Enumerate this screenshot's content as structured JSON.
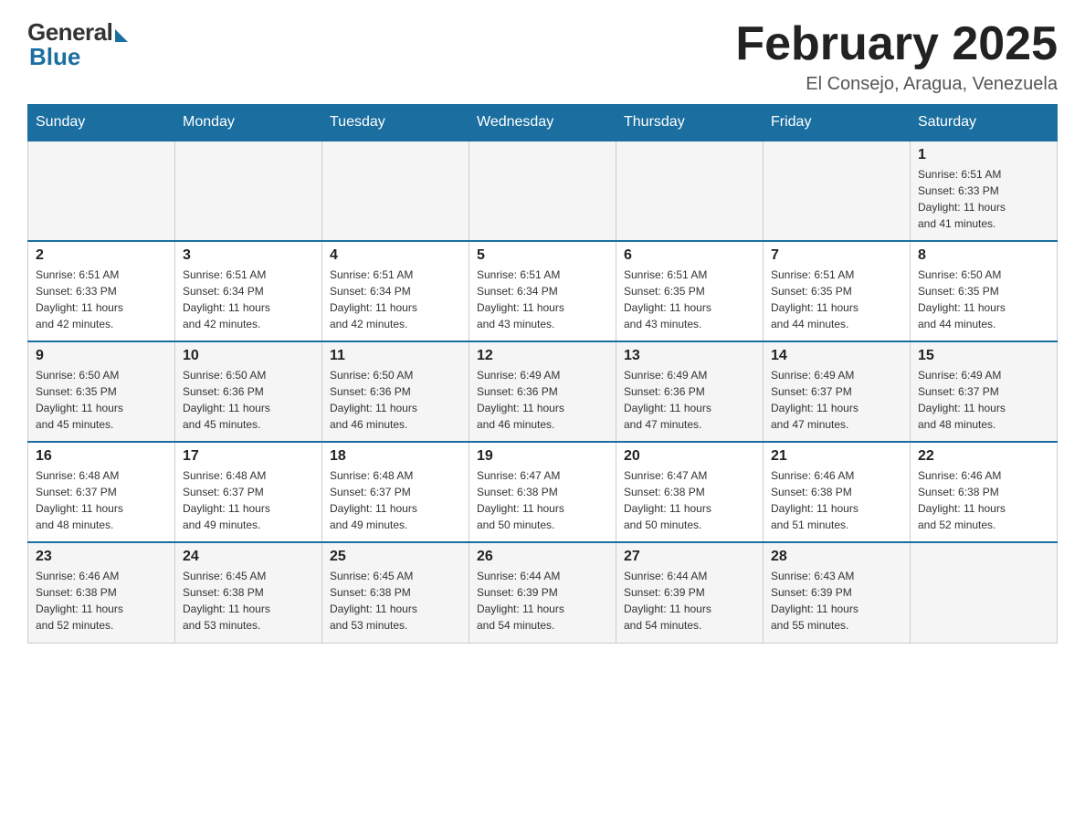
{
  "logo": {
    "general": "General",
    "blue": "Blue"
  },
  "title": {
    "month_year": "February 2025",
    "location": "El Consejo, Aragua, Venezuela"
  },
  "weekdays": [
    "Sunday",
    "Monday",
    "Tuesday",
    "Wednesday",
    "Thursday",
    "Friday",
    "Saturday"
  ],
  "weeks": [
    [
      {
        "day": "",
        "info": ""
      },
      {
        "day": "",
        "info": ""
      },
      {
        "day": "",
        "info": ""
      },
      {
        "day": "",
        "info": ""
      },
      {
        "day": "",
        "info": ""
      },
      {
        "day": "",
        "info": ""
      },
      {
        "day": "1",
        "info": "Sunrise: 6:51 AM\nSunset: 6:33 PM\nDaylight: 11 hours\nand 41 minutes."
      }
    ],
    [
      {
        "day": "2",
        "info": "Sunrise: 6:51 AM\nSunset: 6:33 PM\nDaylight: 11 hours\nand 42 minutes."
      },
      {
        "day": "3",
        "info": "Sunrise: 6:51 AM\nSunset: 6:34 PM\nDaylight: 11 hours\nand 42 minutes."
      },
      {
        "day": "4",
        "info": "Sunrise: 6:51 AM\nSunset: 6:34 PM\nDaylight: 11 hours\nand 42 minutes."
      },
      {
        "day": "5",
        "info": "Sunrise: 6:51 AM\nSunset: 6:34 PM\nDaylight: 11 hours\nand 43 minutes."
      },
      {
        "day": "6",
        "info": "Sunrise: 6:51 AM\nSunset: 6:35 PM\nDaylight: 11 hours\nand 43 minutes."
      },
      {
        "day": "7",
        "info": "Sunrise: 6:51 AM\nSunset: 6:35 PM\nDaylight: 11 hours\nand 44 minutes."
      },
      {
        "day": "8",
        "info": "Sunrise: 6:50 AM\nSunset: 6:35 PM\nDaylight: 11 hours\nand 44 minutes."
      }
    ],
    [
      {
        "day": "9",
        "info": "Sunrise: 6:50 AM\nSunset: 6:35 PM\nDaylight: 11 hours\nand 45 minutes."
      },
      {
        "day": "10",
        "info": "Sunrise: 6:50 AM\nSunset: 6:36 PM\nDaylight: 11 hours\nand 45 minutes."
      },
      {
        "day": "11",
        "info": "Sunrise: 6:50 AM\nSunset: 6:36 PM\nDaylight: 11 hours\nand 46 minutes."
      },
      {
        "day": "12",
        "info": "Sunrise: 6:49 AM\nSunset: 6:36 PM\nDaylight: 11 hours\nand 46 minutes."
      },
      {
        "day": "13",
        "info": "Sunrise: 6:49 AM\nSunset: 6:36 PM\nDaylight: 11 hours\nand 47 minutes."
      },
      {
        "day": "14",
        "info": "Sunrise: 6:49 AM\nSunset: 6:37 PM\nDaylight: 11 hours\nand 47 minutes."
      },
      {
        "day": "15",
        "info": "Sunrise: 6:49 AM\nSunset: 6:37 PM\nDaylight: 11 hours\nand 48 minutes."
      }
    ],
    [
      {
        "day": "16",
        "info": "Sunrise: 6:48 AM\nSunset: 6:37 PM\nDaylight: 11 hours\nand 48 minutes."
      },
      {
        "day": "17",
        "info": "Sunrise: 6:48 AM\nSunset: 6:37 PM\nDaylight: 11 hours\nand 49 minutes."
      },
      {
        "day": "18",
        "info": "Sunrise: 6:48 AM\nSunset: 6:37 PM\nDaylight: 11 hours\nand 49 minutes."
      },
      {
        "day": "19",
        "info": "Sunrise: 6:47 AM\nSunset: 6:38 PM\nDaylight: 11 hours\nand 50 minutes."
      },
      {
        "day": "20",
        "info": "Sunrise: 6:47 AM\nSunset: 6:38 PM\nDaylight: 11 hours\nand 50 minutes."
      },
      {
        "day": "21",
        "info": "Sunrise: 6:46 AM\nSunset: 6:38 PM\nDaylight: 11 hours\nand 51 minutes."
      },
      {
        "day": "22",
        "info": "Sunrise: 6:46 AM\nSunset: 6:38 PM\nDaylight: 11 hours\nand 52 minutes."
      }
    ],
    [
      {
        "day": "23",
        "info": "Sunrise: 6:46 AM\nSunset: 6:38 PM\nDaylight: 11 hours\nand 52 minutes."
      },
      {
        "day": "24",
        "info": "Sunrise: 6:45 AM\nSunset: 6:38 PM\nDaylight: 11 hours\nand 53 minutes."
      },
      {
        "day": "25",
        "info": "Sunrise: 6:45 AM\nSunset: 6:38 PM\nDaylight: 11 hours\nand 53 minutes."
      },
      {
        "day": "26",
        "info": "Sunrise: 6:44 AM\nSunset: 6:39 PM\nDaylight: 11 hours\nand 54 minutes."
      },
      {
        "day": "27",
        "info": "Sunrise: 6:44 AM\nSunset: 6:39 PM\nDaylight: 11 hours\nand 54 minutes."
      },
      {
        "day": "28",
        "info": "Sunrise: 6:43 AM\nSunset: 6:39 PM\nDaylight: 11 hours\nand 55 minutes."
      },
      {
        "day": "",
        "info": ""
      }
    ]
  ]
}
